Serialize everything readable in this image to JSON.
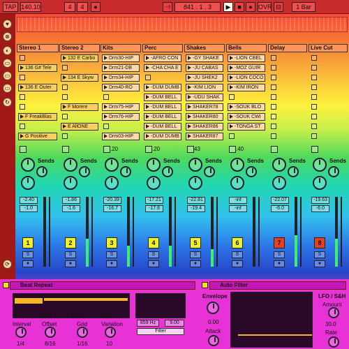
{
  "transport": {
    "tap": "TAP",
    "tempo": "140.10",
    "meter_num": "4",
    "meter_den": "4",
    "position": "841 .  1 .  3",
    "ovr": "OVR",
    "quant": "1 Bar"
  },
  "tracks": [
    {
      "name": "Stereo 1",
      "num": "1",
      "vol": "-2.40",
      "peak": "-1.0",
      "meter": 0.0
    },
    {
      "name": "Stereo 2",
      "num": "2",
      "vol": "-1.86",
      "peak": "-1.6",
      "meter": 0.4
    },
    {
      "name": "Kits",
      "num": "3",
      "vol": "-20.39",
      "peak": "-16.7",
      "meter": 0.3
    },
    {
      "name": "Perc",
      "num": "4",
      "vol": "-17.21",
      "peak": "-17.6",
      "meter": 0.3
    },
    {
      "name": "Shakes",
      "num": "5",
      "vol": "-22.81",
      "peak": "-19.4",
      "meter": 0.25
    },
    {
      "name": "Bells",
      "num": "6",
      "vol": "-inf",
      "peak": "-inf",
      "meter": 0.0
    },
    {
      "name": "Delay",
      "num": "7",
      "vol": "-22.07",
      "peak": "-6.0",
      "meter": 0.45
    },
    {
      "name": "Live Cut",
      "num": "8",
      "vol": "-19.63",
      "peak": "-6.0",
      "meter": 0.4
    }
  ],
  "clips": [
    [
      "",
      "132 E Carbo",
      "Drm30-HIP",
      "-AFRO CON",
      "-GY SHAKE",
      "-LION CBEL"
    ],
    [
      "136 G# Tele",
      "",
      "Drm21-DB",
      "-CHA CHA E",
      "-JU CABAS",
      "-MOZ GUIR"
    ],
    [
      "",
      "134 E Skyw",
      "Drm34-HIP",
      "",
      "-JU SHEK2",
      "-LION COCO"
    ],
    [
      "136 E Outer",
      "",
      "Drm40-RO",
      "-DUM DUMB",
      "-KIM LION",
      "-KIM IRON"
    ],
    [
      "",
      "",
      "",
      "-DUM BELL",
      "-UDU SHAK",
      ""
    ],
    [
      "",
      "F Morere",
      "Drm75-HIP",
      "-DUM BELL",
      "SHAKER78",
      "-SOUK BLO"
    ],
    [
      "F FreakBlas",
      "",
      "Drm76-HIP",
      "-DUM BELL",
      "SHAKER80",
      "-SOUK CWI"
    ],
    [
      "",
      "E AllONE",
      "",
      "-DUM BELL",
      "SHAKER86",
      "-TONGA ST"
    ],
    [
      "G Positive",
      "",
      "Drm03-HIP",
      "-DUM DUMB",
      "SHAKER87",
      ""
    ]
  ],
  "sends_label": "Sends",
  "io": {
    "kits": ".20",
    "perc": ".20",
    "shakes": "43",
    "bells": ".40"
  },
  "beat_repeat": {
    "title": "Beat Repeat",
    "ticks": [
      "0",
      "0.25",
      "0.5",
      "0.75"
    ],
    "interval_label": "Interval",
    "interval": "1/4",
    "offset_label": "Offset",
    "offset": "8/16",
    "grid_label": "Grid",
    "grid": "1/16",
    "variation_label": "Variation",
    "variation": "10",
    "freq": "859 Hz",
    "width": "9.00",
    "filter": "Filter"
  },
  "auto_filter": {
    "title": "Auto Filter",
    "envelope": "Envelope",
    "env_val": "0.00",
    "attack": "Attack",
    "lfo": "LFO / S&H",
    "amount": "Amount",
    "amount_val": "30.0",
    "rate": "Rate"
  },
  "colors": {
    "transport": "#c92a2a",
    "device_bg": "#e832d6",
    "meter": "#3cf06a",
    "track_num": "#f0f028",
    "track_num_active": "#e8401f"
  }
}
